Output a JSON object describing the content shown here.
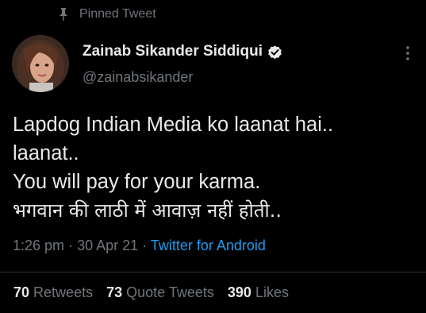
{
  "pinned": {
    "label": "Pinned Tweet",
    "icon": "pin-icon"
  },
  "author": {
    "display_name": "Zainab Sikander Siddiqui",
    "handle": "@zainabsikander",
    "verified_icon": "verified-badge-icon"
  },
  "tweet": {
    "lines": [
      "Lapdog Indian Media ko laanat hai..",
      "laanat..",
      "You will pay for your karma.",
      "भगवान की लाठी में आवाज़ नहीं होती.."
    ]
  },
  "meta": {
    "time": "1:26 pm",
    "separator": "·",
    "date": "30 Apr 21",
    "source": "Twitter for Android"
  },
  "stats": {
    "retweets_count": "70",
    "retweets_label": "Retweets",
    "quotes_count": "73",
    "quotes_label": "Quote Tweets",
    "likes_count": "390",
    "likes_label": "Likes"
  },
  "colors": {
    "background": "#000000",
    "text_primary": "#e7e9ea",
    "text_secondary": "#71767b",
    "link": "#1d9bf0",
    "divider": "#2f3336"
  }
}
